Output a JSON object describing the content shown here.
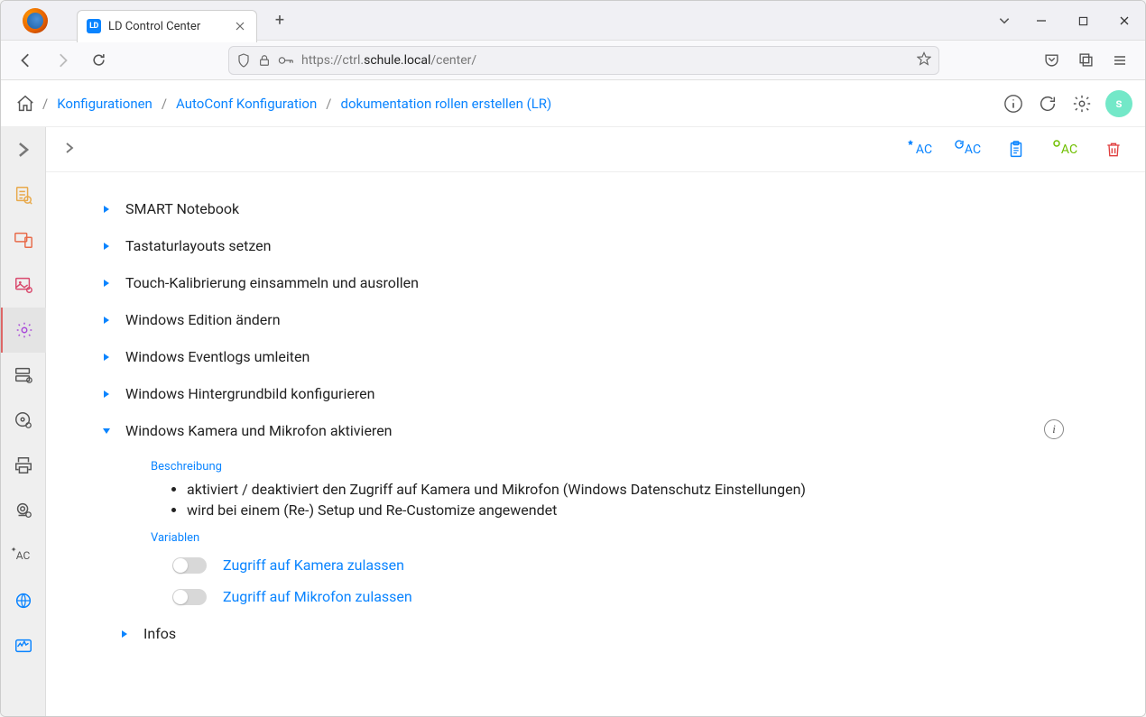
{
  "browser": {
    "tab_title": "LD Control Center",
    "tab_favicon_text": "LD",
    "url_scheme": "https://",
    "url_prefix": "ctrl.",
    "url_host": "schule.local",
    "url_path": "/center/"
  },
  "header": {
    "breadcrumb": {
      "item1": "Konfigurationen",
      "item2": "AutoConf Konfiguration",
      "item3": "dokumentation rollen erstellen (LR)"
    },
    "avatar_initial": "s"
  },
  "toolbar": {
    "ac_blue1": "AC",
    "ac_blue2": "AC",
    "ac_green": "AC"
  },
  "tree": {
    "item1": "SMART Notebook",
    "item2": "Tastaturlayouts setzen",
    "item3": "Touch-Kalibrierung einsammeln und ausrollen",
    "item4": "Windows Edition ändern",
    "item5": "Windows Eventlogs umleiten",
    "item6": "Windows Hintergrundbild konfigurieren",
    "item7": "Windows Kamera und Mikrofon aktivieren",
    "infos": "Infos"
  },
  "expanded": {
    "section_beschreibung": "Beschreibung",
    "desc1": "aktiviert / deaktiviert den Zugriff auf Kamera und Mikrofon (Windows Datenschutz Einstellungen)",
    "desc2": "wird bei einem (Re-) Setup und Re-Customize angewendet",
    "section_variablen": "Variablen",
    "var1": "Zugriff auf Kamera zulassen",
    "var2": "Zugriff auf Mikrofon zulassen",
    "info_tooltip": "i"
  }
}
